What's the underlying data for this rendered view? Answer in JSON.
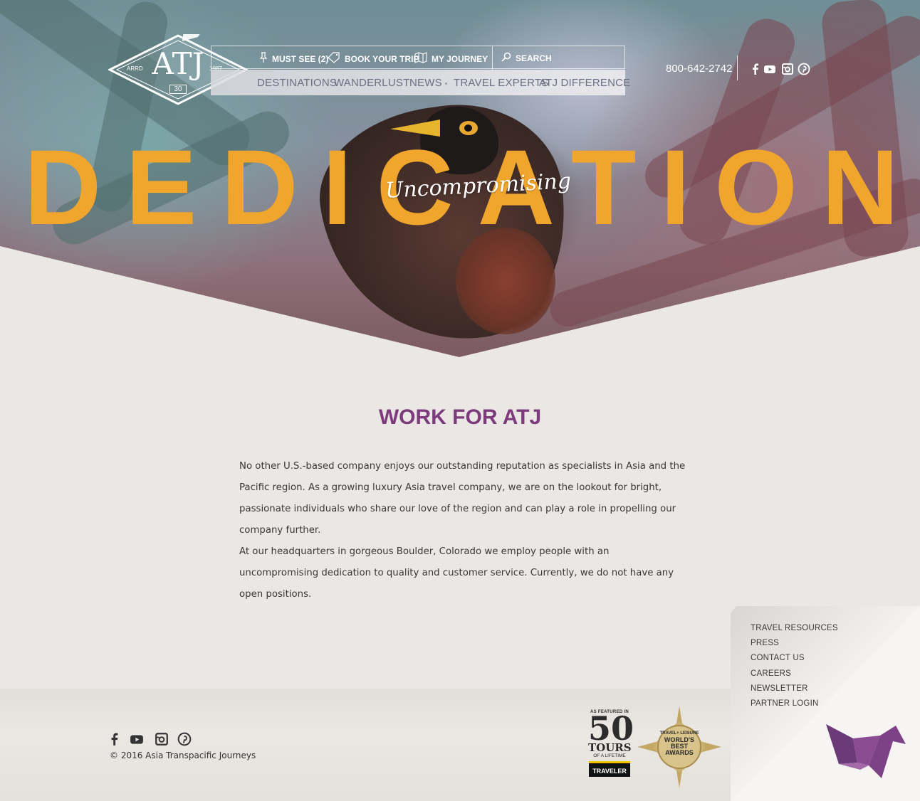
{
  "brand": {
    "logo_text": "ATJ",
    "logo_left": "ARRD",
    "logo_right": "1987",
    "logo_badge": "30"
  },
  "utility_nav": {
    "must_see": "MUST SEE (2)",
    "book_trip": "BOOK YOUR TRIP",
    "my_journey": "MY JOURNEY",
    "search_placeholder": "SEARCH"
  },
  "main_nav": [
    "DESTINATIONS",
    "WANDERLUST",
    "NEWS",
    "TRAVEL EXPERTS",
    "ATJ DIFFERENCE"
  ],
  "header": {
    "phone": "800-642-2742",
    "social_icons": [
      "facebook-icon",
      "youtube-icon",
      "instagram-icon",
      "pinterest-icon"
    ]
  },
  "hero": {
    "word": "DEDICATION",
    "script": "Uncompromising"
  },
  "content": {
    "title": "WORK FOR ATJ",
    "paragraphs": [
      "No other U.S.-based company enjoys our outstanding reputation as specialists in Asia and the Pacific region. As a growing luxury Asia travel company, we are on the lookout for bright, passionate individuals who share our love of the region and can play a role in propelling our company further.",
      "At our headquarters in gorgeous Boulder, Colorado we employ people with an uncompromising dedication to quality and customer service. Currently, we do not have any open positions."
    ]
  },
  "footer": {
    "copyright": "© 2016 Asia Transpacific Journeys",
    "links": [
      "TRAVEL RESOURCES",
      "PRESS",
      "CONTACT US",
      "CAREERS",
      "NEWSLETTER",
      "PARTNER LOGIN"
    ],
    "badge_50": {
      "top": "AS FEATURED IN",
      "number": "50",
      "tours": "TOURS",
      "life": "OF A LIFETIME",
      "brand": "TRAVELER"
    },
    "award": {
      "line1": "TRAVEL+ LEISURE",
      "line2": "WORLD'S",
      "line3": "BEST",
      "line4": "AWARDS"
    }
  },
  "colors": {
    "accent_purple": "#7d3b7d",
    "hero_orange": "#f0a52c",
    "nav_text": "#6b6f83",
    "background": "#ebe7e4"
  }
}
